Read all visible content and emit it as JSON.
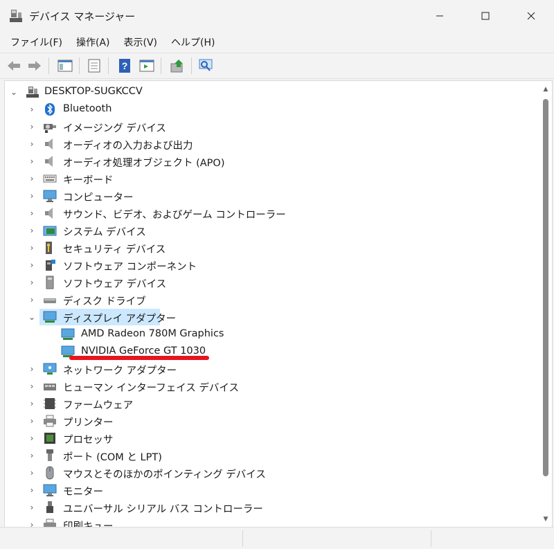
{
  "window": {
    "title": "デバイス マネージャー",
    "controls": {
      "minimize": "—",
      "maximize": "☐",
      "close": "✕"
    }
  },
  "menu": {
    "items": [
      "ファイル(F)",
      "操作(A)",
      "表示(V)",
      "ヘルプ(H)"
    ]
  },
  "toolbar": {
    "buttons": [
      "back-icon",
      "forward-icon",
      "show-hide-console-tree-icon",
      "properties-icon",
      "help-icon",
      "action-pane-icon",
      "update-driver-icon",
      "scan-hardware-icon"
    ]
  },
  "tree": {
    "root": "DESKTOP-SUGKCCV",
    "categories": [
      {
        "label": "Bluetooth",
        "icon": "bluetooth-icon"
      },
      {
        "label": "イメージング デバイス",
        "icon": "camera-icon"
      },
      {
        "label": "オーディオの入力および出力",
        "icon": "speaker-icon"
      },
      {
        "label": "オーディオ処理オブジェクト (APO)",
        "icon": "speaker-icon"
      },
      {
        "label": "キーボード",
        "icon": "keyboard-icon"
      },
      {
        "label": "コンピューター",
        "icon": "monitor-icon"
      },
      {
        "label": "サウンド、ビデオ、およびゲーム コントローラー",
        "icon": "speaker-icon"
      },
      {
        "label": "システム デバイス",
        "icon": "system-folder-icon"
      },
      {
        "label": "セキュリティ デバイス",
        "icon": "security-key-icon"
      },
      {
        "label": "ソフトウェア コンポーネント",
        "icon": "software-component-icon"
      },
      {
        "label": "ソフトウェア デバイス",
        "icon": "software-device-icon"
      },
      {
        "label": "ディスク ドライブ",
        "icon": "disk-drive-icon"
      },
      {
        "label": "ディスプレイ アダプター",
        "icon": "display-adapter-icon",
        "expanded": true,
        "selected": true,
        "children": [
          {
            "label": "AMD Radeon 780M Graphics",
            "icon": "display-adapter-icon"
          },
          {
            "label": "NVIDIA GeForce GT 1030",
            "icon": "display-adapter-icon"
          }
        ]
      },
      {
        "label": "ネットワーク アダプター",
        "icon": "network-adapter-icon"
      },
      {
        "label": "ヒューマン インターフェイス デバイス",
        "icon": "hid-icon"
      },
      {
        "label": "ファームウェア",
        "icon": "firmware-icon"
      },
      {
        "label": "プリンター",
        "icon": "printer-icon"
      },
      {
        "label": "プロセッサ",
        "icon": "processor-icon"
      },
      {
        "label": "ポート (COM と LPT)",
        "icon": "port-icon"
      },
      {
        "label": "マウスとそのほかのポインティング デバイス",
        "icon": "mouse-icon"
      },
      {
        "label": "モニター",
        "icon": "monitor-icon"
      },
      {
        "label": "ユニバーサル シリアル バス コントローラー",
        "icon": "usb-icon"
      },
      {
        "label": "印刷キュー",
        "icon": "print-queue-icon"
      }
    ]
  },
  "annotation": {
    "underline_color": "#e8141c"
  },
  "colors": {
    "selection": "#cce8ff",
    "background": "#f3f3f3",
    "pane": "#ffffff"
  }
}
